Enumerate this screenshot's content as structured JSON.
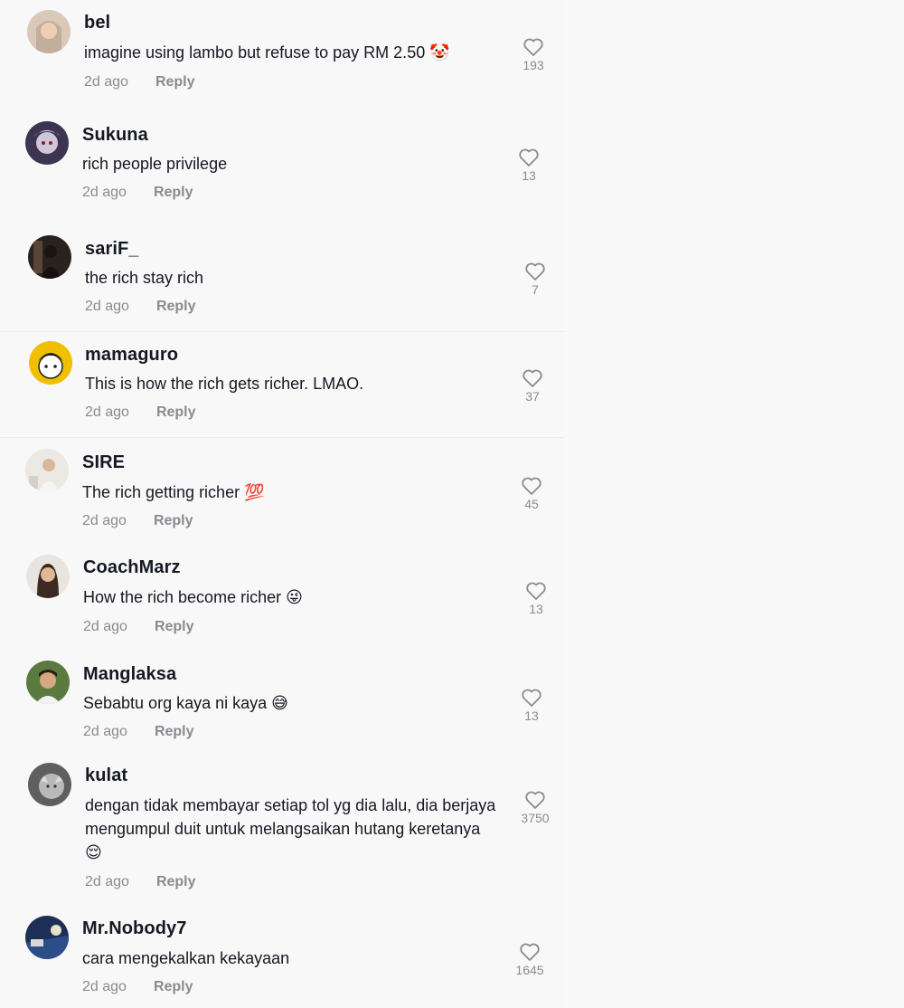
{
  "comments": [
    {
      "username": "bel",
      "text": "imagine using lambo but refuse to pay RM 2.50 🤡",
      "time": "2d ago",
      "reply": "Reply",
      "likes": "193",
      "avatar_color": "#c9b8a8"
    },
    {
      "username": "Sukuna",
      "text": "rich people privilege",
      "time": "2d ago",
      "reply": "Reply",
      "likes": "13",
      "avatar_color": "#5a4f6b"
    },
    {
      "username": "sariF_",
      "text": "the rich stay rich",
      "time": "2d ago",
      "reply": "Reply",
      "likes": "7",
      "avatar_color": "#3a2f2a"
    },
    {
      "username": "mamaguro",
      "text": "This is how the rich gets richer. LMAO.",
      "time": "2d ago",
      "reply": "Reply",
      "likes": "37",
      "avatar_color": "#f2c200"
    },
    {
      "username": "SIRE",
      "text": "The rich getting richer 💯",
      "time": "2d ago",
      "reply": "Reply",
      "likes": "45",
      "avatar_color": "#e6e3df"
    },
    {
      "username": "CoachMarz",
      "text": "How the rich become richer 😜",
      "time": "2d ago",
      "reply": "Reply",
      "likes": "13",
      "avatar_color": "#d9cfc7"
    },
    {
      "username": "Manglaksa",
      "text": "Sebabtu org kaya ni kaya 😅",
      "time": "2d ago",
      "reply": "Reply",
      "likes": "13",
      "avatar_color": "#4d6b3a"
    },
    {
      "username": "kulat",
      "text": "dengan tidak membayar setiap tol yg dia lalu, dia berjaya mengumpul duit untuk melangsaikan hutang keretanya😌",
      "time": "2d ago",
      "reply": "Reply",
      "likes": "3750",
      "avatar_color": "#9a9a9a"
    },
    {
      "username": "Mr.Nobody7",
      "text": "cara mengekalkan kekayaan",
      "time": "2d ago",
      "reply": "Reply",
      "likes": "1645",
      "avatar_color": "#2f4a7a"
    }
  ],
  "colors": {
    "text": "#161823",
    "muted": "#8a8b91",
    "background": "#f8f8f8"
  },
  "icons": {
    "like": "heart-outline-icon"
  }
}
